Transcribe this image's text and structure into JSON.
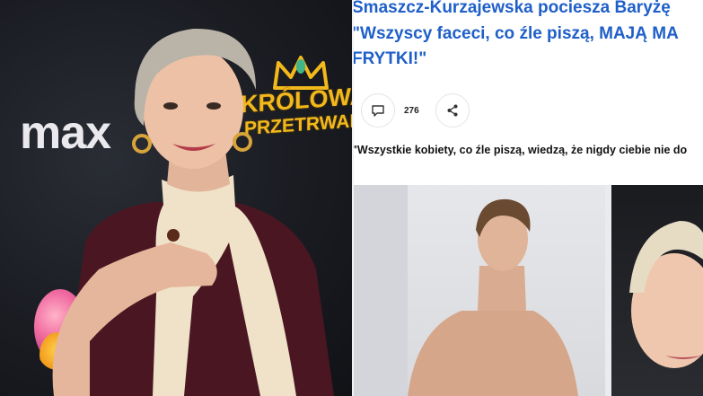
{
  "left_panel": {
    "brand_logo": "max",
    "show_logo_line1": "KRÓLOWA",
    "show_logo_line2": "PRZETRWANIA"
  },
  "article": {
    "headline_line1": "Smaszcz-Kurzajewska pociesza Baryżę",
    "headline_line2": "\"Wszyscy faceci, co źle piszą, MAJĄ MA",
    "headline_line3": "FRYTKI!\"",
    "comment_count": "276",
    "quote": "\"Wszystkie kobiety, co źle piszą, wiedzą, że nigdy ciebie nie do",
    "icons": {
      "comment": "comment-icon",
      "share": "share-icon"
    }
  },
  "colors": {
    "headline_blue": "#1f5fc9",
    "crown_gold": "#f2b81c",
    "background_dark": "#1a1c22"
  }
}
